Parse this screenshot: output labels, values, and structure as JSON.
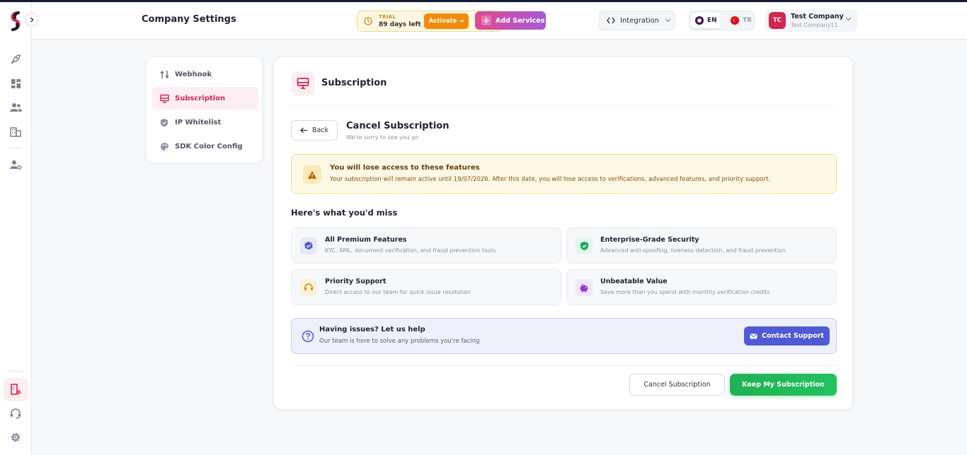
{
  "header": {
    "title": "Company Settings",
    "trial": {
      "label": "TRIAL",
      "days_left": "89 days left",
      "activate": "Activate →"
    },
    "add_services": "Add Services",
    "integration": "Integration",
    "languages": {
      "en": "EN",
      "tr": "TR"
    },
    "company": {
      "initials": "TC",
      "name": "Test Company",
      "sub": "Test Company11"
    }
  },
  "rail": {
    "icons": [
      "rocket-icon",
      "dashboard-icon",
      "users-icon",
      "building-icon",
      "user-settings-icon",
      "company-settings-icon",
      "support-icon",
      "gear-icon"
    ],
    "active_color": "#d4264f"
  },
  "menu": {
    "items": [
      {
        "label": "Webhook",
        "icon": "webhook-icon"
      },
      {
        "label": "Subscription",
        "icon": "monitor-icon"
      },
      {
        "label": "IP Whitelist",
        "icon": "shield-icon"
      },
      {
        "label": "SDK Color Config",
        "icon": "palette-icon"
      }
    ],
    "active": "Subscription"
  },
  "main": {
    "section_title": "Subscription",
    "back": "Back",
    "cancel_title": "Cancel Subscription",
    "cancel_sub": "We're sorry to see you go",
    "warning": {
      "title": "You will lose access to these features",
      "text": "Your subscription will remain active until 19/07/2026. After this date, you will lose access to verifications, advanced features, and priority support."
    },
    "miss_title": "Here's what you'd miss",
    "features": [
      {
        "title": "All Premium Features",
        "desc": "KYC, AML, document verification, and fraud prevention tools",
        "icon": "verified-badge-icon",
        "color": "#4f5bd5"
      },
      {
        "title": "Enterprise-Grade Security",
        "desc": "Advanced anti-spoofing, liveness detection, and fraud prevention",
        "icon": "shield-check-icon",
        "color": "#1fa463"
      },
      {
        "title": "Priority Support",
        "desc": "Direct access to our team for quick issue resolution",
        "icon": "headset-icon",
        "color": "#e08a0c"
      },
      {
        "title": "Unbeatable Value",
        "desc": "Save more than you spend with monthly verification credits",
        "icon": "piggy-bank-icon",
        "color": "#8a3fd1"
      }
    ],
    "help": {
      "title": "Having issues? Let us help",
      "text": "Our team is here to solve any problems you're facing",
      "button": "Contact Support"
    },
    "actions": {
      "cancel": "Cancel Subscription",
      "keep": "Keep My Subscription"
    }
  }
}
